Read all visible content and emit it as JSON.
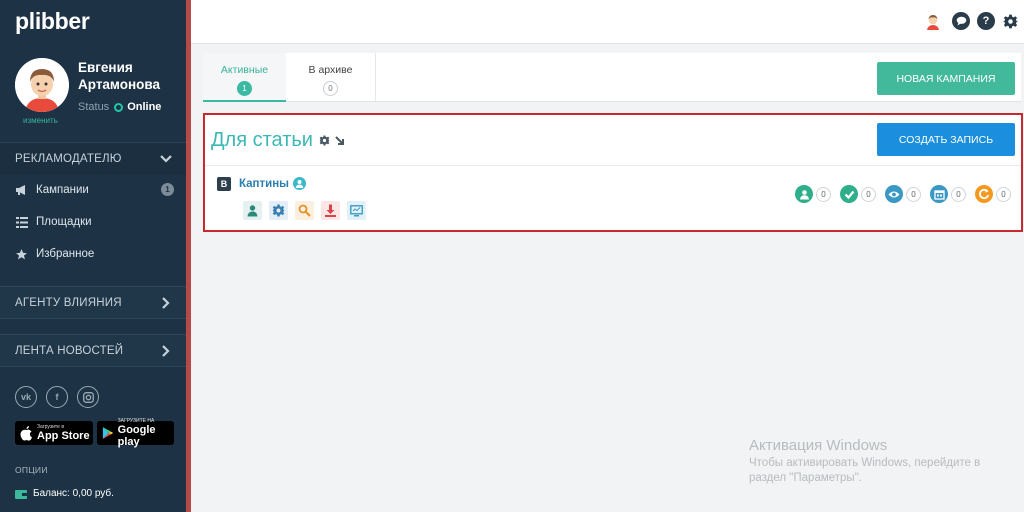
{
  "colors": {
    "sidebar_bg": "#1d3345",
    "accent_teal": "#43b99c",
    "primary_blue": "#1b8fdd",
    "highlight_red": "#c9282d",
    "title_teal": "#3bb8b4"
  },
  "sidebar": {
    "logo": "plibber",
    "change_link": "изменить",
    "user_name": "Евгения Артамонова",
    "status_label": "Status",
    "status_value": "Online",
    "advertiser_section": "РЕКЛАМОДАТЕЛЮ",
    "items": [
      {
        "label": "Кампании",
        "icon": "megaphone-icon",
        "badge": "1"
      },
      {
        "label": "Площадки",
        "icon": "list-icon"
      },
      {
        "label": "Избранное",
        "icon": "star-icon"
      }
    ],
    "agent_section": "АГЕНТУ ВЛИЯНИЯ",
    "news_section": "ЛЕНТА НОВОСТЕЙ",
    "socials": [
      "vk-icon",
      "facebook-icon",
      "instagram-icon"
    ],
    "app_store": {
      "small": "Загрузите в",
      "big": "App Store"
    },
    "google_play": {
      "small": "ЗАГРУЗИТЕ НА",
      "big": "Google play"
    },
    "options_label": "ОПЦИИ",
    "balance": "Баланс: 0,00 руб."
  },
  "topbar": {
    "icons": [
      "avatar-icon",
      "chat-icon",
      "help-icon",
      "gear-icon"
    ]
  },
  "tabs": [
    {
      "label": "Активные",
      "count": "1",
      "active": true
    },
    {
      "label": "В архиве",
      "count": "0",
      "active": false
    }
  ],
  "new_campaign_label": "НОВАЯ КАМПАНИЯ",
  "campaign": {
    "title": "Для статьи",
    "create_label": "СОЗДАТЬ ЗАПИСЬ",
    "network_badge": "В",
    "channel_name": "Каптины",
    "actions": [
      "person-icon",
      "gear-icon",
      "search-icon",
      "download-icon",
      "monitor-icon"
    ],
    "stats": [
      {
        "icon": "user-icon",
        "color": "#2fae8c",
        "count": "0"
      },
      {
        "icon": "check-icon",
        "color": "#2fae8c",
        "count": "0"
      },
      {
        "icon": "eye-icon",
        "color": "#3a98c4",
        "count": "0"
      },
      {
        "icon": "calendar-icon",
        "color": "#3a98c4",
        "count": "0"
      },
      {
        "icon": "refresh-icon",
        "color": "#f39a1e",
        "count": "0"
      }
    ]
  },
  "watermark": {
    "title": "Активация Windows",
    "text": "Чтобы активировать Windows, перейдите в раздел \"Параметры\"."
  }
}
